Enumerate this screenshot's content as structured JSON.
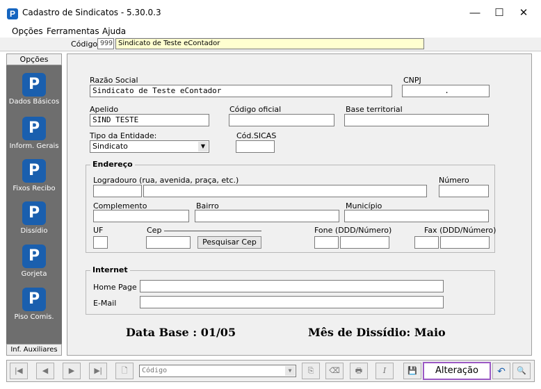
{
  "window": {
    "title": "Cadastro de Sindicatos - 5.30.0.3",
    "minimize": "—",
    "maximize": "☐",
    "close": "✕",
    "app_icon": "P"
  },
  "menu": [
    "Opções",
    "Ferramentas",
    "Ajuda"
  ],
  "codebar": {
    "label": "Código:",
    "code": "999",
    "name": "Sindicato de Teste eContador"
  },
  "sidebar": {
    "header": "Opções",
    "footer": "Inf. Auxiliares",
    "icon_glyph": "P",
    "items": [
      "Dados Básicos",
      "Inform. Gerais",
      "Fixos Recibo",
      "Dissídio",
      "Gorjeta",
      "Piso Comis."
    ]
  },
  "form": {
    "razao_label": "Razão Social",
    "razao_value": "Sindicato de Teste eContador",
    "cnpj_label": "CNPJ",
    "cnpj_value": ".",
    "apelido_label": "Apelido",
    "apelido_value": "SIND TESTE",
    "codigo_oficial_label": "Código oficial",
    "codigo_oficial_value": "",
    "base_label": "Base territorial",
    "base_value": "",
    "tipo_label": "Tipo da Entidade:",
    "tipo_value": "Sindicato",
    "sicas_label": "Cód.SICAS",
    "sicas_value": ""
  },
  "endereco": {
    "title": "Endereço",
    "logradouro_label": "Logradouro (rua, avenida, praça, etc.)",
    "numero_label": "Número",
    "complemento_label": "Complemento",
    "bairro_label": "Bairro",
    "municipio_label": "Município",
    "uf_label": "UF",
    "cep_label": "Cep",
    "pesquisar_cep": "Pesquisar Cep",
    "fone_label": "Fone (DDD/Número)",
    "fax_label": "Fax (DDD/Número)"
  },
  "internet": {
    "title": "Internet",
    "home_label": "Home Page",
    "email_label": "E-Mail"
  },
  "info": {
    "data_base": "Data Base : 01/05",
    "mes_dissidio": "Mês de Dissídio:  Maio"
  },
  "toolbar": {
    "first": "|◀",
    "prev": "◀",
    "next": "▶",
    "last": "▶|",
    "new": "🗋",
    "code_placeholder": "Código",
    "status": "Alteração",
    "undo": "↶",
    "search": "🔍",
    "save": "💾",
    "italic": "I",
    "print": "🖶"
  }
}
